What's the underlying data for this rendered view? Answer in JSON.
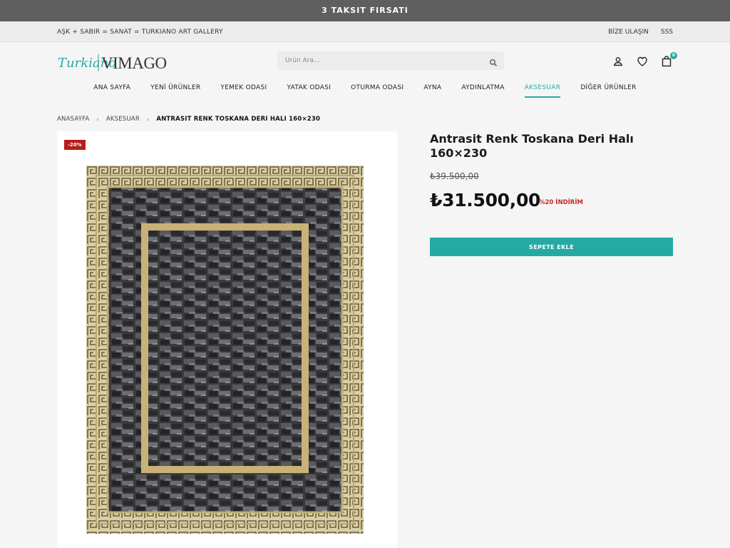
{
  "promo": {
    "text": "3 TAKSIT FIRSATI"
  },
  "topbar": {
    "tagline": "AŞK + SABIR = SANAT = TURKIANO ART GALLERY",
    "links": [
      "BİZE ULAŞIN",
      "SSS"
    ]
  },
  "logo": {
    "script": "Turkiano",
    "brand": "VIMAGO"
  },
  "search": {
    "placeholder": "Ürün Ara..."
  },
  "header_icons": {
    "account": "user-icon",
    "wishlist": "heart-icon",
    "cart": "bag-icon",
    "cart_count": "0"
  },
  "nav": {
    "items": [
      "ANA SAYFA",
      "YENİ ÜRÜNLER",
      "YEMEK ODASI",
      "YATAK ODASI",
      "OTURMA ODASI",
      "AYNA",
      "AYDINLATMA",
      "AKSESUAR",
      "DİĞER ÜRÜNLER"
    ],
    "active": "AKSESUAR"
  },
  "breadcrumb": {
    "items": [
      "ANASAYFA",
      "AKSESUAR"
    ],
    "current": "ANTRASIT RENK TOSKANA DERI HALI 160×230"
  },
  "product": {
    "discount_badge": "-20%",
    "title": "Antrasit Renk Toskana Deri Halı 160×230",
    "old_price": "₺39.500,00",
    "price": "₺31.500,00",
    "discount_text": "%20 İNDİRİM",
    "add_to_cart": "SEPETE EKLE"
  },
  "colors": {
    "accent": "#26a9a3",
    "promo_bg": "#5f5f5f",
    "sale": "#c62828"
  }
}
